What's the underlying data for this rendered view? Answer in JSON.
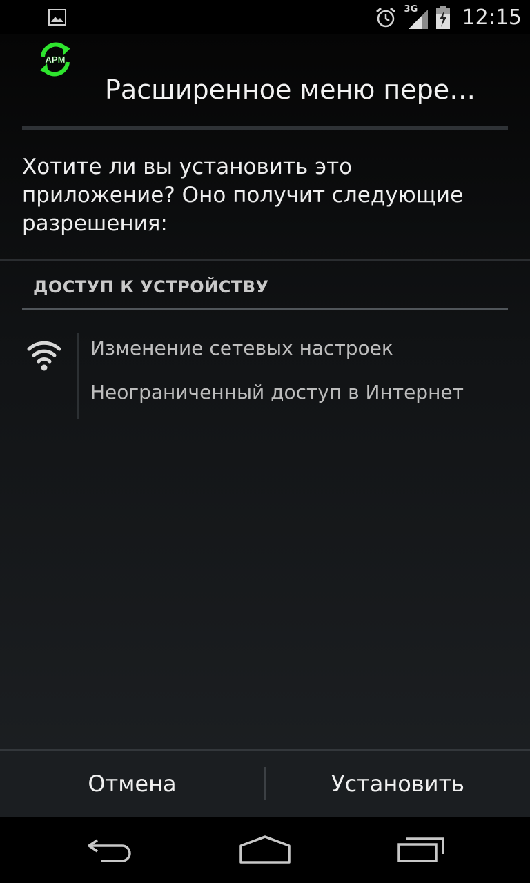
{
  "status_bar": {
    "time": "12:15",
    "network": "3G",
    "icons": [
      "gallery-notification-icon",
      "alarm-icon",
      "signal-3g-icon",
      "battery-charging-icon"
    ]
  },
  "dialog": {
    "app_icon": "apm-sync-icon",
    "app_icon_text": "APM",
    "title": "Расширенное меню пере…",
    "question": "Хотите ли вы установить это приложение? Оно получит следующие разрешения:",
    "section_header": "ДОСТУП К УСТРОЙСТВУ",
    "permission_group_icon": "wifi-icon",
    "permissions": [
      "Изменение сетевых настроек",
      "Неограниченный доступ в Интернет"
    ]
  },
  "buttons": {
    "cancel_label": "Отмена",
    "install_label": "Установить"
  },
  "navigation": {
    "icons": [
      "back-icon",
      "home-icon",
      "recent-apps-icon"
    ]
  },
  "colors": {
    "app_icon_accent": "#2ee52e",
    "background_dark": "#000000",
    "button_bar": "#1b1e21"
  }
}
